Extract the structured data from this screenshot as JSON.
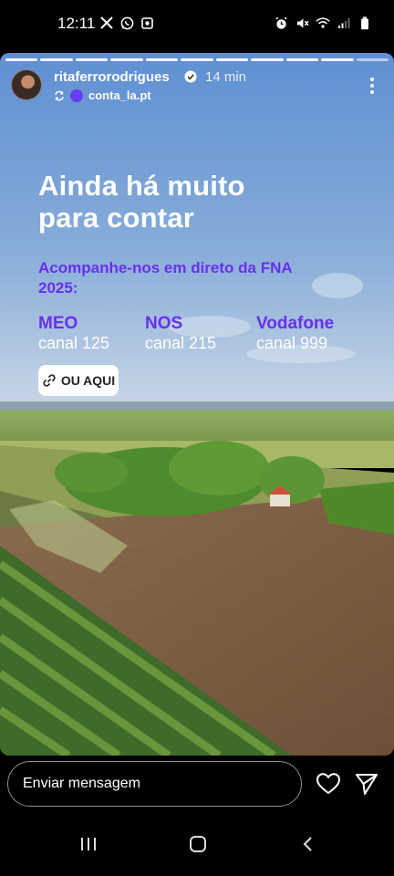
{
  "status_bar": {
    "time": "12:11",
    "left_icons": [
      "x-icon",
      "whatsapp-icon",
      "notification-icon"
    ],
    "right_icons": [
      "alarm-icon",
      "mute-icon",
      "wifi-icon",
      "signal-icon",
      "battery-icon"
    ]
  },
  "story": {
    "progress_segments": 11,
    "progress_done": 10,
    "username": "ritaferrorodrigues",
    "time_ago": "14 min",
    "collab_name": "conta_la.pt",
    "headline": "Ainda há muito para contar",
    "sub_headline": "Acompanhe-nos em direto da FNA 2025:",
    "channels": [
      {
        "name": "MEO",
        "number": "canal 125"
      },
      {
        "name": "NOS",
        "number": "canal 215"
      },
      {
        "name": "Vodafone",
        "number": "canal 999"
      }
    ],
    "cta_label": "OU AQUI"
  },
  "reply": {
    "placeholder": "Enviar mensagem"
  },
  "colors": {
    "accent_purple": "#6a2ff0",
    "background": "#000000"
  }
}
